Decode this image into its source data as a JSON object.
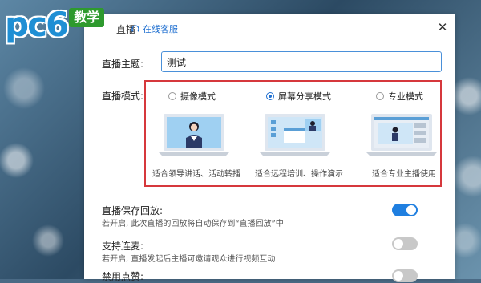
{
  "watermark": {
    "logo_text": "pc6",
    "badge": "教学"
  },
  "dialog": {
    "title": "直播",
    "online_service": "在线客服",
    "close_glyph": "✕"
  },
  "topic": {
    "label": "直播主题:",
    "value": "测试"
  },
  "mode": {
    "label": "直播模式:",
    "options": [
      {
        "label": "摄像模式",
        "desc": "适合领导讲话、活动转播",
        "selected": false
      },
      {
        "label": "屏幕分享模式",
        "desc": "适合远程培训、操作演示",
        "selected": true
      },
      {
        "label": "专业模式",
        "desc": "适合专业主播使用",
        "selected": false
      }
    ]
  },
  "settings": [
    {
      "title": "直播保存回放:",
      "desc": "若开启, 此次直播的回放将自动保存到“直播回放”中",
      "on": true
    },
    {
      "title": "支持连麦:",
      "desc": "若开启, 直播发起后主播可邀请观众进行视频互动",
      "on": false
    },
    {
      "title": "禁用点赞:",
      "desc": "",
      "on": false
    }
  ],
  "colors": {
    "accent": "#1f7fe0",
    "highlight_border": "#d6383c",
    "logo_blue": "#1f8fd4",
    "badge_green": "#2e9a2e"
  }
}
